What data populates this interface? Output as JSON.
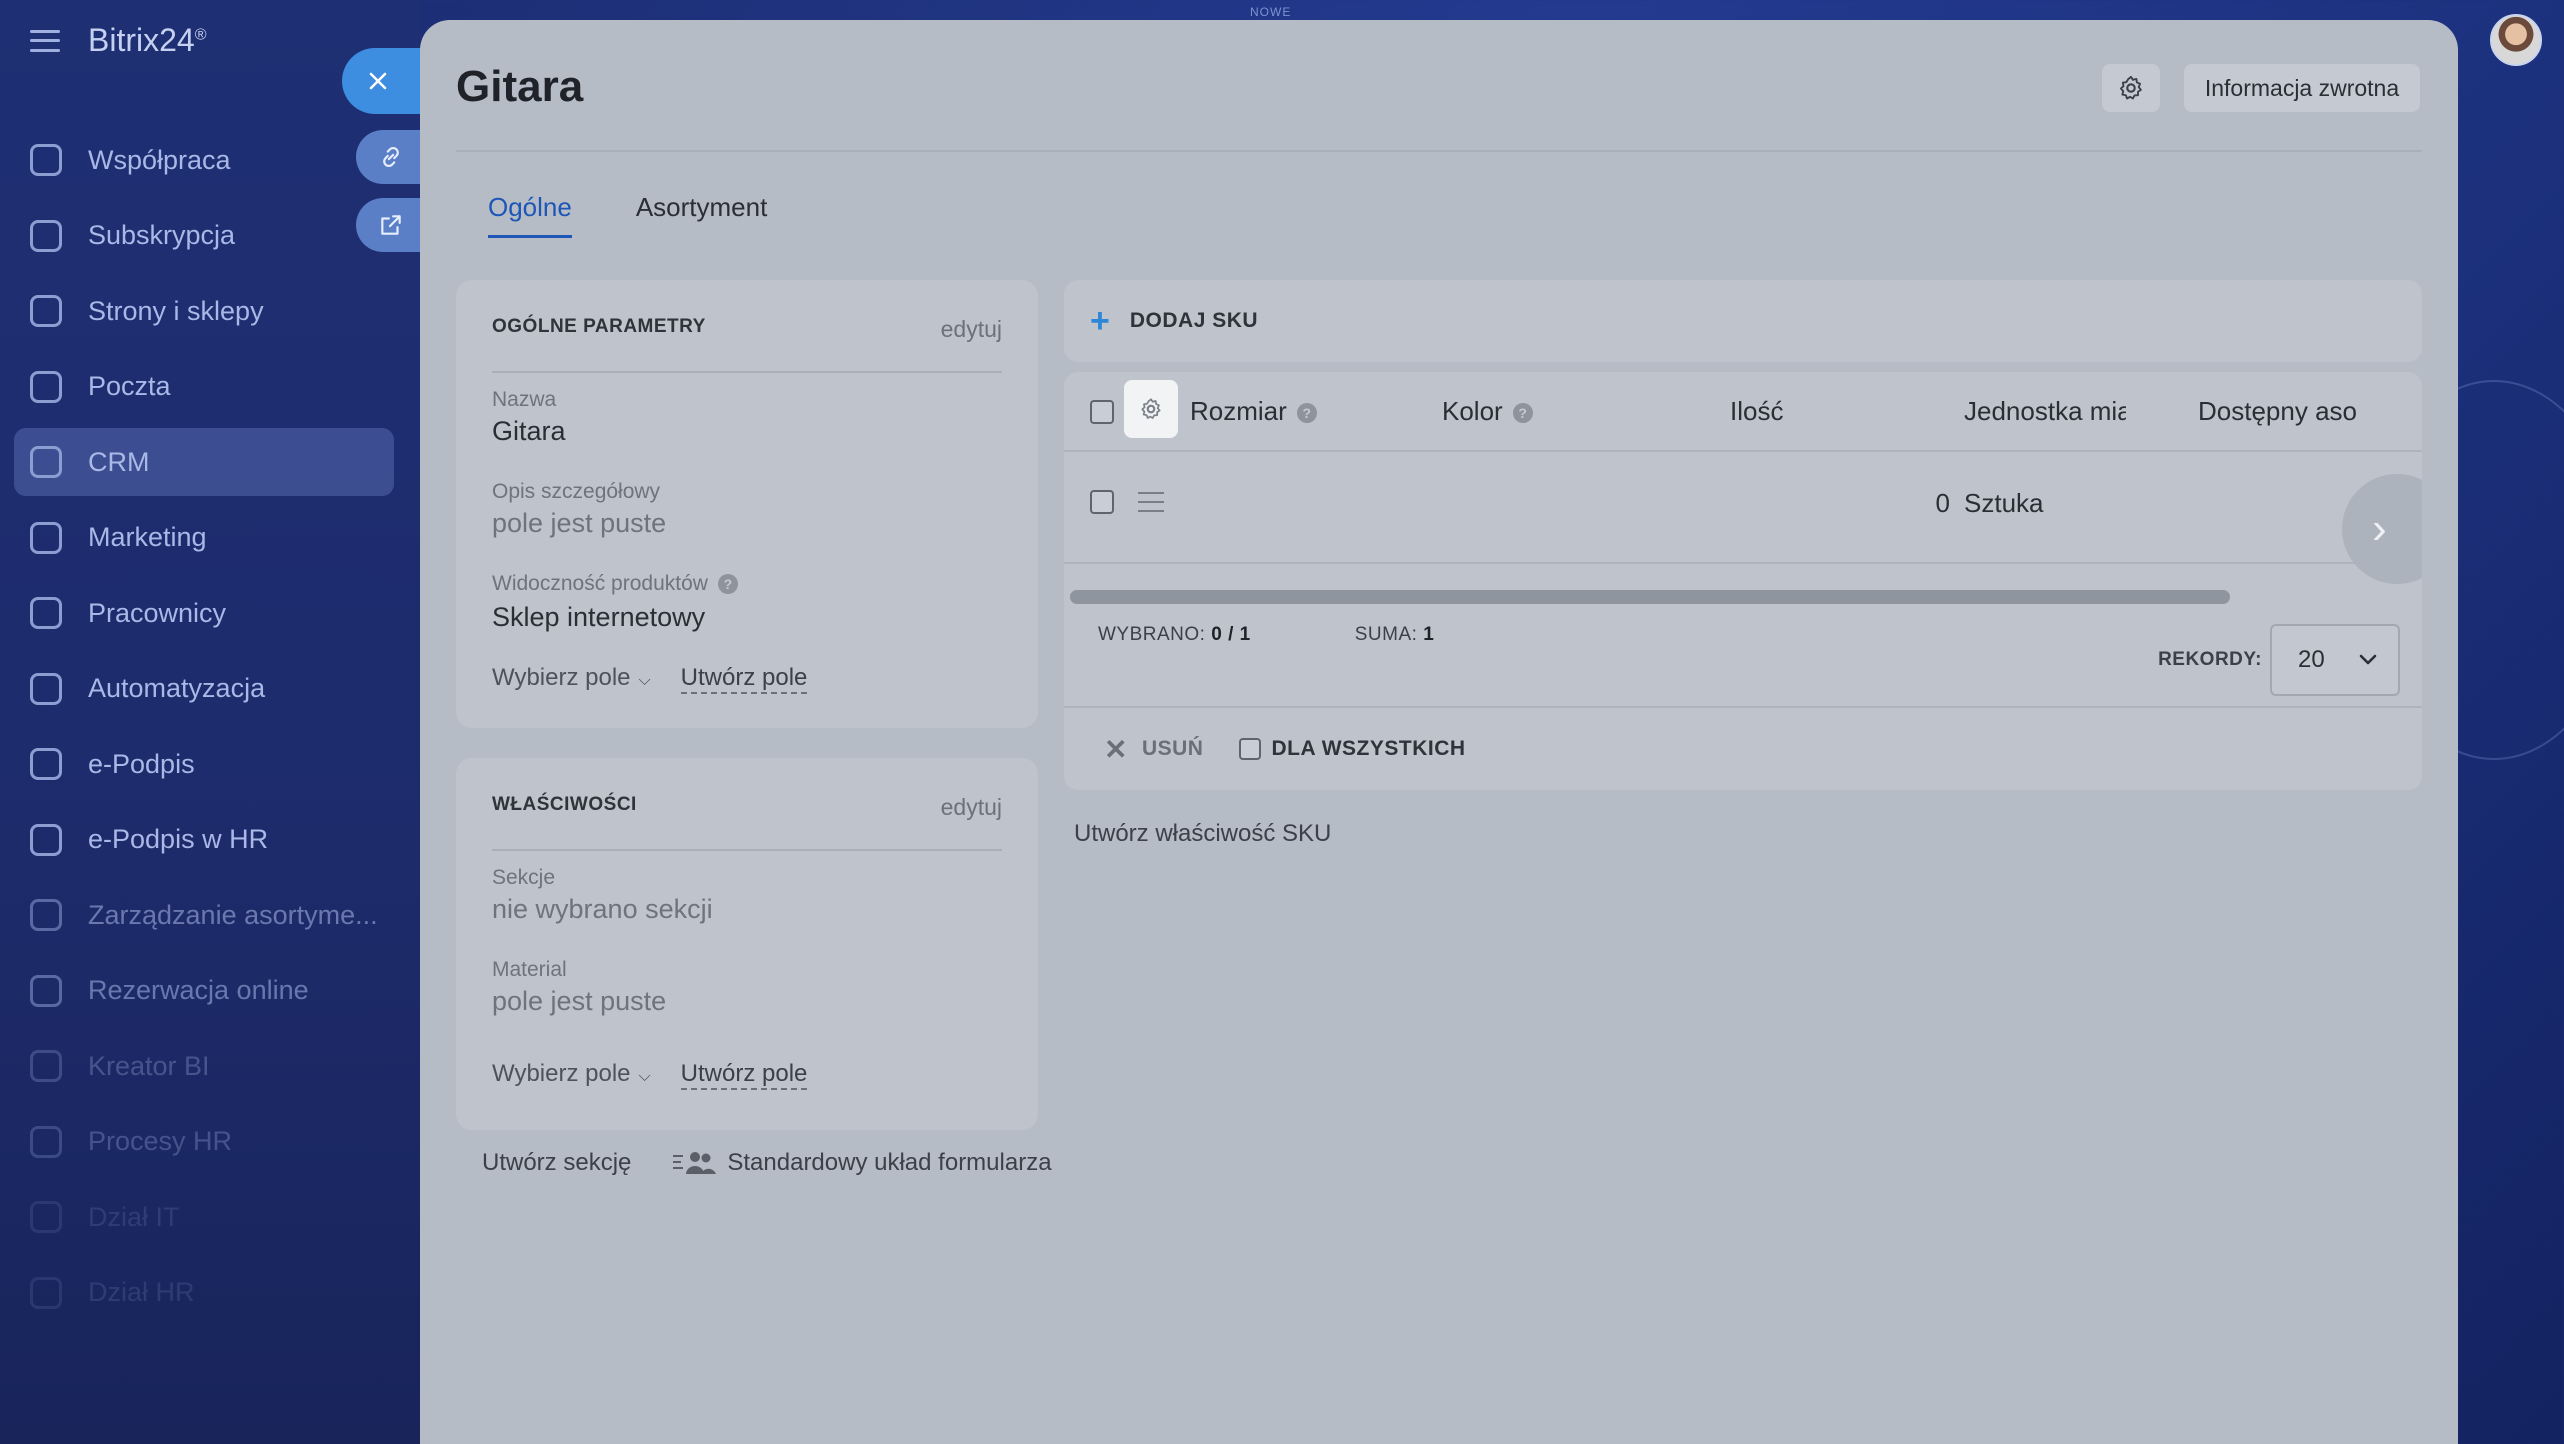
{
  "app": {
    "logo": "Bitrix24",
    "logo_mark": "®",
    "top_label": "NOWE"
  },
  "sidebar": {
    "items": [
      {
        "label": "Współpraca",
        "icon": "chat-icon"
      },
      {
        "label": "Subskrypcja",
        "icon": "subscription-icon"
      },
      {
        "label": "Strony i sklepy",
        "icon": "cart-icon"
      },
      {
        "label": "Poczta",
        "icon": "mail-icon"
      },
      {
        "label": "CRM",
        "icon": "crm-icon"
      },
      {
        "label": "Marketing",
        "icon": "target-icon"
      },
      {
        "label": "Pracownicy",
        "icon": "id-card-icon"
      },
      {
        "label": "Automatyzacja",
        "icon": "robot-icon"
      },
      {
        "label": "e-Podpis",
        "icon": "signature-icon"
      },
      {
        "label": "e-Podpis w HR",
        "icon": "document-sign-icon"
      },
      {
        "label": "Zarządzanie asortyme...",
        "icon": "warehouse-icon"
      },
      {
        "label": "Rezerwacja online",
        "icon": "calendar-icon"
      },
      {
        "label": "Kreator BI",
        "icon": "bar-chart-icon"
      },
      {
        "label": "Procesy HR",
        "icon": "hr-icon"
      },
      {
        "label": "Dział IT",
        "icon": "it-icon"
      },
      {
        "label": "Dział HR",
        "icon": "department-icon"
      }
    ]
  },
  "panel": {
    "title": "Gitara",
    "feedback_label": "Informacja zwrotna",
    "tabs": [
      {
        "label": "Ogólne"
      },
      {
        "label": "Asortyment"
      }
    ],
    "general": {
      "title": "OGÓLNE PARAMETRY",
      "edit": "edytuj",
      "fields": [
        {
          "label": "Nazwa",
          "value": "Gitara"
        },
        {
          "label": "Opis szczegółowy",
          "value": "pole jest puste"
        },
        {
          "label": "Widoczność produktów",
          "value": "Sklep internetowy"
        }
      ],
      "choose_field": "Wybierz pole",
      "create_field": "Utwórz pole"
    },
    "properties": {
      "title": "WŁAŚCIWOŚCI",
      "edit": "edytuj",
      "fields": [
        {
          "label": "Sekcje",
          "value": "nie wybrano sekcji"
        },
        {
          "label": "Material",
          "value": "pole jest puste"
        }
      ],
      "choose_field": "Wybierz pole",
      "create_field": "Utwórz pole"
    },
    "create_section": "Utwórz sekcję",
    "standard_layout": "Standardowy układ formularza",
    "sku": {
      "add_label": "DODAJ SKU",
      "columns": [
        "Rozmiar",
        "Kolor",
        "Ilość",
        "Jednostka mia",
        "Dostępny aso"
      ],
      "rows": [
        {
          "rozmiar": "",
          "kolor": "",
          "ilosc": "0",
          "jednostka": "Sztuka",
          "dostepny": ""
        }
      ],
      "selected_label": "WYBRANO:",
      "selected_value": "0 / 1",
      "sum_label": "SUMA:",
      "sum_value": "1",
      "records_label": "REKORDY:",
      "records_value": "20",
      "delete_label": "USUŃ",
      "for_all_label": "DLA WSZYSTKICH",
      "create_property": "Utwórz właściwość SKU"
    }
  }
}
